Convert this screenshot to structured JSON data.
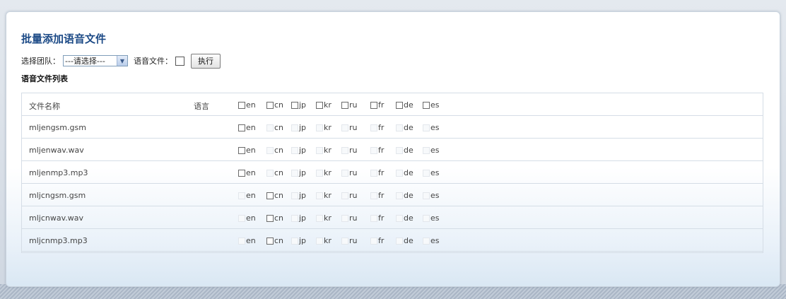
{
  "page": {
    "title": "批量添加语音文件",
    "team_label": "选择团队：",
    "team_select_value": "---请选择---",
    "voice_file_label": "语音文件：",
    "execute_button": "执行",
    "list_heading": "语音文件列表"
  },
  "table": {
    "headers": {
      "file_name": "文件名称",
      "language": "语言"
    },
    "languages": [
      "en",
      "cn",
      "jp",
      "kr",
      "ru",
      "fr",
      "de",
      "es"
    ],
    "rows": [
      {
        "file": "mljengsm.gsm",
        "enabled": [
          "en"
        ]
      },
      {
        "file": "mljenwav.wav",
        "enabled": [
          "en"
        ]
      },
      {
        "file": "mljenmp3.mp3",
        "enabled": [
          "en"
        ]
      },
      {
        "file": "mljcngsm.gsm",
        "enabled": [
          "cn"
        ]
      },
      {
        "file": "mljcnwav.wav",
        "enabled": [
          "cn"
        ]
      },
      {
        "file": "mljcnmp3.mp3",
        "enabled": [
          "cn"
        ]
      }
    ]
  },
  "colors": {
    "title": "#1c4a86",
    "row_border": "#d5dde6"
  }
}
